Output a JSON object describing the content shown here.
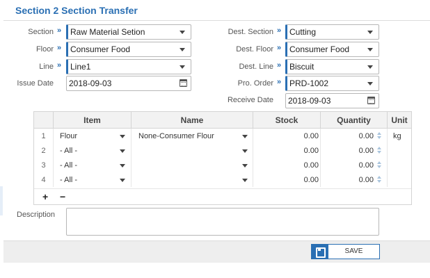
{
  "form": {
    "title": "Section 2 Section Transfer",
    "left": [
      {
        "label": "Section",
        "value": "Raw Material Setion",
        "type": "select"
      },
      {
        "label": "Floor",
        "value": "Consumer Food",
        "type": "select"
      },
      {
        "label": "Line",
        "value": "Line1",
        "type": "select"
      },
      {
        "label": "Issue Date",
        "value": "2018-09-03",
        "type": "date"
      }
    ],
    "right": [
      {
        "label": "Dest. Section",
        "value": "Cutting",
        "type": "select"
      },
      {
        "label": "Dest. Floor",
        "value": "Consumer Food",
        "type": "select"
      },
      {
        "label": "Dest. Line",
        "value": "Biscuit",
        "type": "select"
      },
      {
        "label": "Pro. Order",
        "value": "PRD-1002",
        "type": "select"
      },
      {
        "label": "Receive Date",
        "value": "2018-09-03",
        "type": "date"
      }
    ],
    "required_marker": "»"
  },
  "grid": {
    "columns": {
      "item": "Item",
      "name": "Name",
      "stock": "Stock",
      "quantity": "Quantity",
      "unit": "Unit"
    },
    "rows": [
      {
        "num": "1",
        "item": "Flour",
        "name": "None-Consumer Flour",
        "stock": "0.00",
        "quantity": "0.00",
        "unit": "kg"
      },
      {
        "num": "2",
        "item": "- All -",
        "name": "",
        "stock": "0.00",
        "quantity": "0.00",
        "unit": ""
      },
      {
        "num": "3",
        "item": "- All -",
        "name": "",
        "stock": "0.00",
        "quantity": "0.00",
        "unit": ""
      },
      {
        "num": "4",
        "item": "- All -",
        "name": "",
        "stock": "0.00",
        "quantity": "0.00",
        "unit": ""
      }
    ],
    "add_label": "+",
    "remove_label": "−"
  },
  "description": {
    "label": "Description",
    "value": ""
  },
  "footer": {
    "save_label": "SAVE"
  },
  "colors": {
    "accent": "#2a6fb3"
  }
}
